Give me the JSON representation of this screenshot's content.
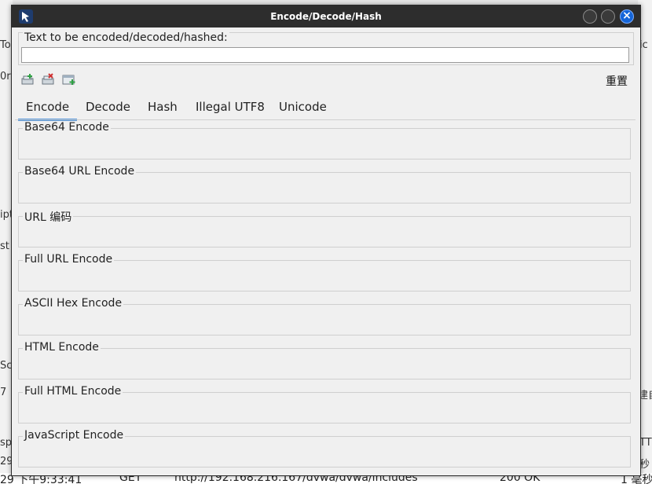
{
  "dialog": {
    "title": "Encode/Decode/Hash",
    "input_label": "Text to be encoded/decoded/hashed:",
    "input_value": "",
    "reset_label": "重置",
    "tabs": [
      {
        "label": "Encode",
        "active": true
      },
      {
        "label": "Decode",
        "active": false
      },
      {
        "label": "Hash",
        "active": false
      },
      {
        "label": "Illegal UTF8",
        "active": false
      },
      {
        "label": "Unicode",
        "active": false
      }
    ],
    "sections": [
      "Base64 Encode",
      "Base64 URL Encode",
      "URL 编码",
      "Full URL Encode",
      "ASCII Hex Encode",
      "HTML Encode",
      "Full HTML Encode",
      "JavaScript Encode"
    ],
    "toolbar_icons": [
      "add-tab-icon",
      "remove-tab-icon",
      "add-output-icon"
    ],
    "close_symbol": "×"
  },
  "background": {
    "bottom_row": {
      "time": "29 下午9:33:41",
      "method": "GET",
      "url": "http://192.168.216.167/dvwa/dvwa/includes",
      "status": "200 OK",
      "duration": "1 毫秒"
    },
    "left_fragments": [
      "To",
      "0r",
      "ipt",
      "st",
      "Sc",
      "7",
      "sp",
      "29"
    ],
    "right_fragments": [
      "ic",
      "建自",
      "TT",
      "秒"
    ]
  },
  "colors": {
    "titlebar": "#2d2d2d",
    "tab_active_underline": "#4a90d9",
    "close_button": "#1565d8"
  }
}
